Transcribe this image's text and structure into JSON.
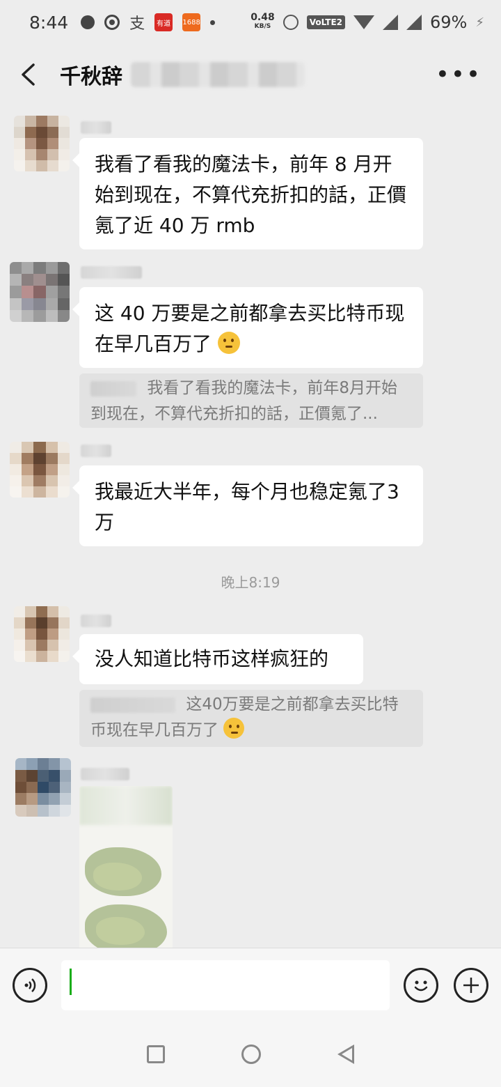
{
  "status_bar": {
    "time": "8:44",
    "app_label_1": "有道",
    "app_label_2": "1688",
    "net_speed": "0.48",
    "net_unit": "KB/S",
    "volte": "VoLTE2",
    "battery": "69%"
  },
  "header": {
    "title": "千秋辞",
    "back_icon": "chevron-left-icon",
    "more_icon": "more-dots-icon"
  },
  "messages": [
    {
      "text": "我看了看我的魔法卡，前年 8 月开始到现在，不算代充折扣的話，正價氪了近 40 万 rmb"
    },
    {
      "text": "这 40 万要是之前都拿去买比特币现在早几百万了",
      "emoji": "thinking-face-icon",
      "quote": "我看了看我的魔法卡，前年8月开始到现在，不算代充折扣的話，正價氪了..."
    },
    {
      "text": "我最近大半年，每个月也稳定氪了3 万"
    },
    {
      "text": "没人知道比特币这样疯狂的",
      "quote": "这40万要是之前都拿去买比特币现在早几百万了",
      "quote_emoji": "thinking-face-icon"
    }
  ],
  "time_separator": "晚上8:19",
  "input": {
    "value": "",
    "placeholder": ""
  },
  "colors": {
    "background": "#ededed",
    "bubble": "#ffffff",
    "quote": "#e2e2e2",
    "caret": "#1aad19"
  }
}
